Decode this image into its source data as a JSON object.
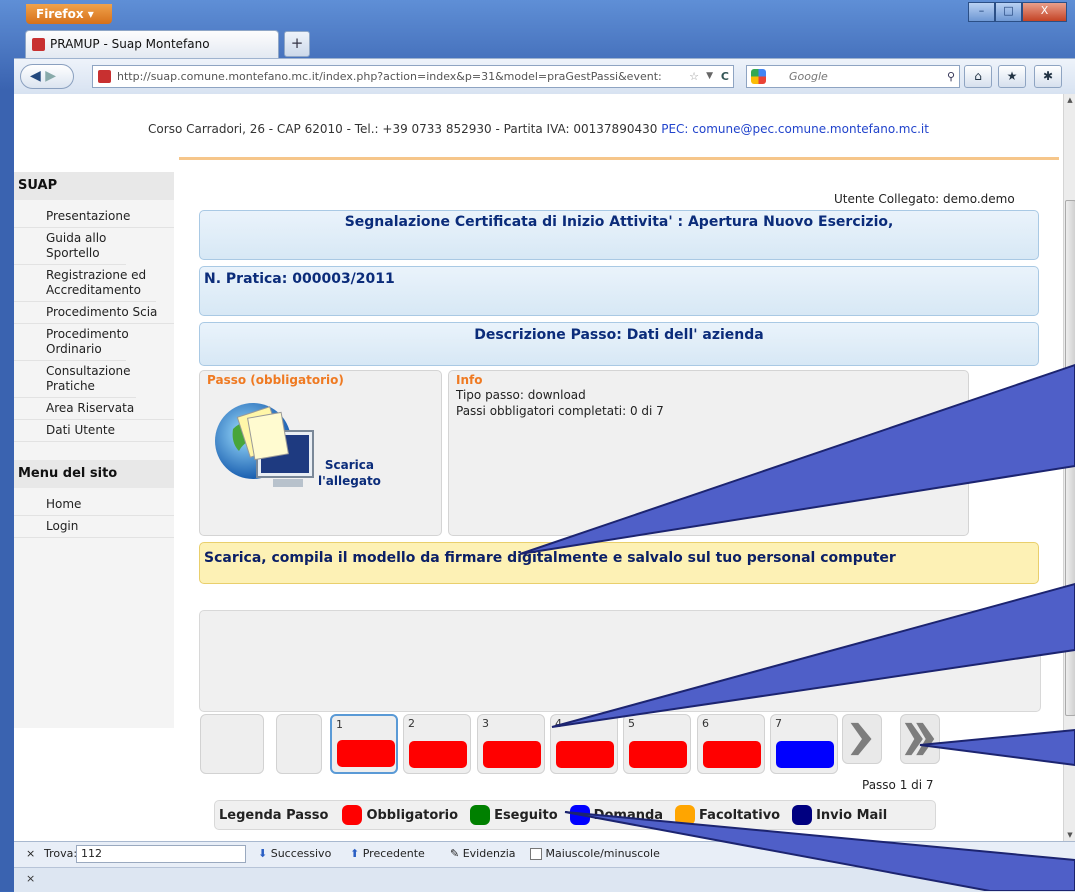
{
  "browser": {
    "menu_label": "Firefox",
    "tab_title": "PRAMUP - Suap Montefano",
    "url": "http://suap.comune.montefano.mc.it/index.php?action=index&p=31&model=praGestPassi&event:",
    "search_placeholder": "Google",
    "min_symbol": "–",
    "max_symbol": "□",
    "close_symbol": "X"
  },
  "header": {
    "address": "Corso Carradori, 26 - CAP 62010 - Tel.: +39 0733 852930 - Partita IVA: 00137890430",
    "pec": "PEC: comune@pec.comune.montefano.mc.it"
  },
  "sidebar": {
    "section1_title": "SUAP",
    "items": [
      "Presentazione",
      "Guida allo Sportello",
      "Registrazione ed Accreditamento",
      "Procedimento Scia",
      "Procedimento Ordinario",
      "Consultazione Pratiche",
      "Area Riservata",
      "Dati Utente"
    ],
    "section2_title": "Menu del sito",
    "site_items": [
      "Home",
      "Login"
    ]
  },
  "user": {
    "label": "Utente Collegato: demo.demo"
  },
  "pratica": {
    "title": "Segnalazione Certificata di Inizio Attivita' : Apertura Nuovo Esercizio,",
    "number": "N. Pratica: 000003/2011",
    "step_description": "Descrizione Passo: Dati dell' azienda"
  },
  "step_panel": {
    "title": "Passo (obbligatorio)",
    "download_label_1": "Scarica",
    "download_label_2": "l'allegato"
  },
  "info_panel": {
    "title": "Info",
    "type": "Tipo passo: download",
    "progress": "Passi obbligatori completati: 0 di 7"
  },
  "instruction": "Scarica, compila il modello da firmare digitalmente e salvalo sul tuo personal computer",
  "steps": [
    {
      "num": "1",
      "color": "#ff0000"
    },
    {
      "num": "2",
      "color": "#ff0000"
    },
    {
      "num": "3",
      "color": "#ff0000"
    },
    {
      "num": "4",
      "color": "#ff0000"
    },
    {
      "num": "5",
      "color": "#ff0000"
    },
    {
      "num": "6",
      "color": "#ff0000"
    },
    {
      "num": "7",
      "color": "#0000ff"
    }
  ],
  "step_position": "Passo 1 di 7",
  "legend": {
    "title": "Legenda Passo",
    "items": [
      {
        "label": "Obbligatorio",
        "color": "#ff0000"
      },
      {
        "label": "Eseguito",
        "color": "#008000"
      },
      {
        "label": "Domanda",
        "color": "#0000ff"
      },
      {
        "label": "Facoltativo",
        "color": "#ffa500"
      },
      {
        "label": "Invio Mail",
        "color": "#000080"
      }
    ]
  },
  "findbar": {
    "close": "×",
    "label": "Trova:",
    "value": "112",
    "next": "Successivo",
    "prev": "Precedente",
    "highlight": "Evidenzia",
    "case": "Maiuscole/minuscole"
  },
  "statusbar": {
    "close": "×"
  }
}
